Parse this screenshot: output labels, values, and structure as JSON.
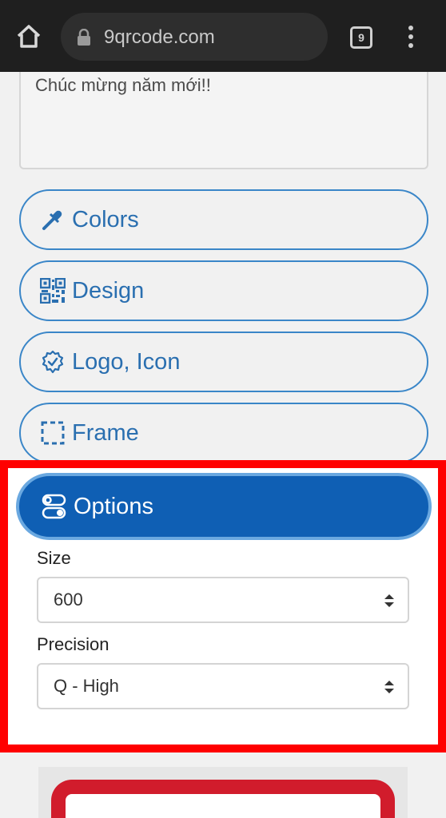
{
  "browser": {
    "url": "9qrcode.com",
    "tab_count": "9"
  },
  "content": {
    "textarea_value": "Chúc mừng năm mới!!",
    "sections": {
      "colors": "Colors",
      "design": "Design",
      "logo": "Logo, Icon",
      "frame": "Frame",
      "options": "Options"
    },
    "options": {
      "size_label": "Size",
      "size_value": "600",
      "precision_label": "Precision",
      "precision_value": "Q - High"
    }
  },
  "colors": {
    "accent": "#2a6fb0",
    "options_bg": "#0f5fb4",
    "highlight": "#ff0000",
    "frame_red": "#d11c2c"
  }
}
